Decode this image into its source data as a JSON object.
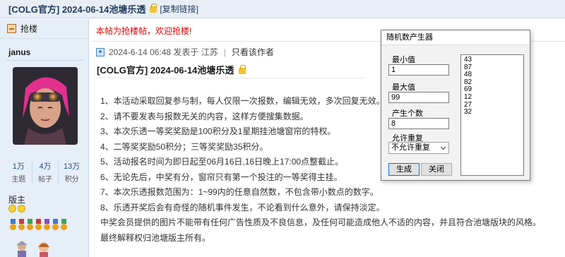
{
  "thread": {
    "title": "[COLG官方] 2024-06-14池塘乐透",
    "copy_link": "[复制链接]"
  },
  "sidebar": {
    "floor_button": "抢楼",
    "username": "janus",
    "stats": [
      {
        "value": "1万",
        "label": "主题"
      },
      {
        "value": "4万",
        "label": "帖子"
      },
      {
        "value": "13万",
        "label": "积分"
      }
    ],
    "role": "版主"
  },
  "post": {
    "notice": "本帖为抢楼帖，欢迎抢楼!",
    "meta": {
      "date_text": "2024-6-14 06:48 发表于 江苏",
      "only_author": "只看该作者"
    },
    "title": "[COLG官方] 2024-06-14池塘乐透",
    "rules": [
      "1、本活动采取回复参与制，每人仅限一次报数，编辑无效，多次回复无效。",
      "2、请不要发表与报数无关的内容，这样方便搜集数据。",
      "3、本次乐透一等奖奖励是100积分及1星期挂池塘窗帘的特权。",
      "4、二等奖奖励50积分；三等奖奖励35积分。",
      "5、活动报名时间为即日起至06月16日,16日晚上17:00点整截止。",
      "6、无论先后，中奖有分，窗帘只有第一个投注的一等奖得主挂。",
      "7、本次乐透报数范围为：1~99内的任意自然数，不包含带小数点的数字。",
      "8、乐透开奖后会有奇怪的随机事件发生，不论看到什么意外，请保持淡定。",
      "中奖会员提供的图片不能带有任何广告性质及不良信息，及任何可能造成他人不适的内容，并且符合池塘版块的风格。",
      "最终解释权归池塘版主所有。"
    ]
  },
  "rng_dialog": {
    "title": "随机数产生器",
    "min_label": "最小值",
    "min_value": "1",
    "max_label": "最大值",
    "max_value": "99",
    "count_label": "产生个数",
    "count_value": "8",
    "repeat_label": "允许重复",
    "repeat_value": "不允许重复",
    "generate_label": "生成",
    "close_label": "关闭",
    "results": [
      "43",
      "87",
      "48",
      "82",
      "69",
      "12",
      "27",
      "32"
    ]
  },
  "colors": {
    "notice_red": "#e00000",
    "sidebar_bg": "#e6eef8",
    "link_blue": "#1f3a5a"
  }
}
